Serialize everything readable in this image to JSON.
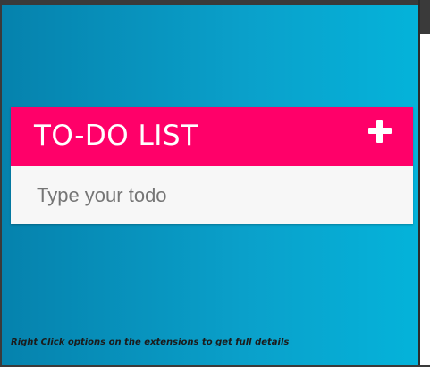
{
  "app": {
    "title": "TO-DO LIST",
    "add_icon": "plus-icon"
  },
  "input": {
    "placeholder": "Type your todo",
    "value": ""
  },
  "footer": {
    "note": "Right Click options on the extensions to get full details"
  },
  "colors": {
    "header": "#ff0069",
    "background_start": "#0582ad",
    "background_end": "#04b3da",
    "input_background": "#f7f7f7"
  }
}
